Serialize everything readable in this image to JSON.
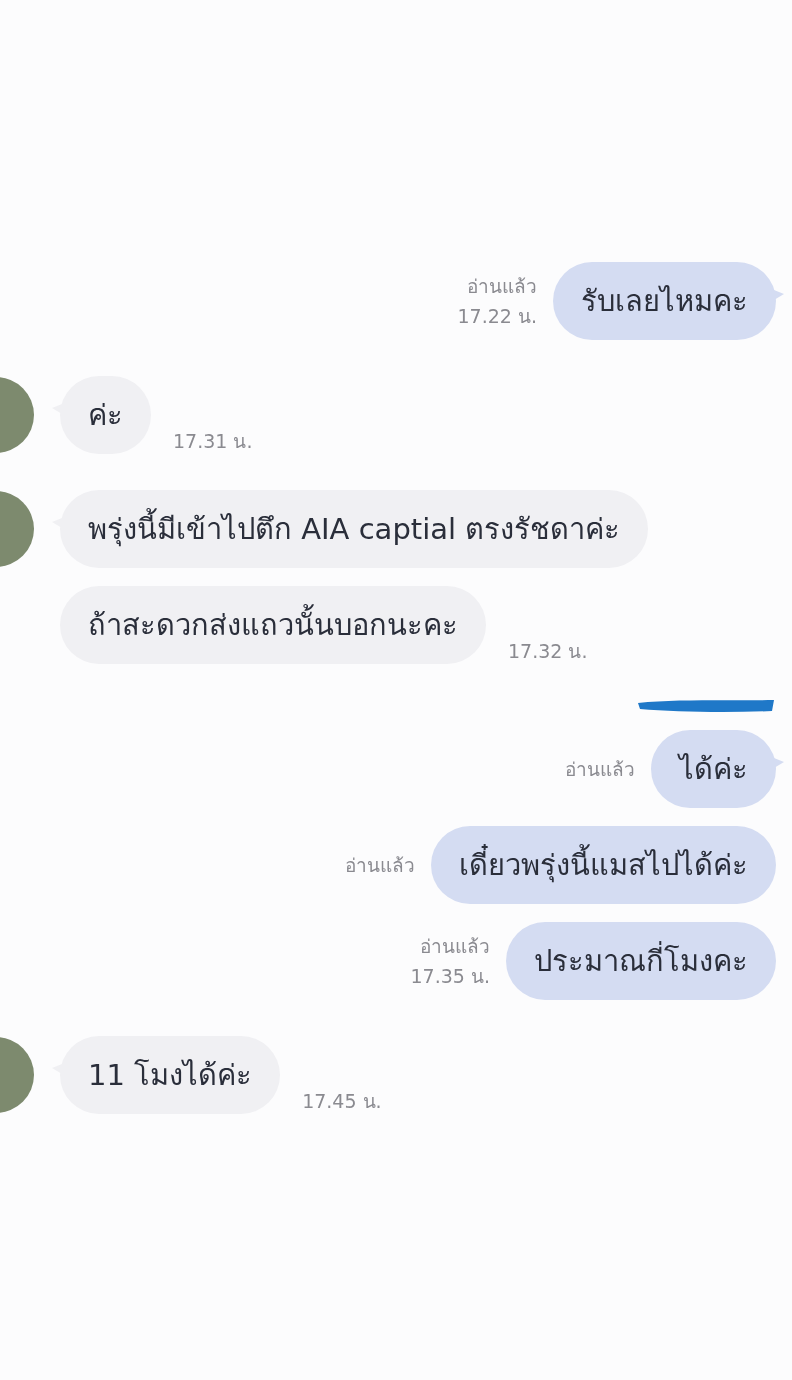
{
  "messages": [
    {
      "kind": "sent",
      "text": "รับเลยไหมคะ",
      "read": "อ่านแล้ว",
      "time": "17.22 น.",
      "tail": true,
      "redaction_above": false
    },
    {
      "kind": "received",
      "text": "ค่ะ",
      "time": "17.31 น.",
      "tail": true
    },
    {
      "kind": "received",
      "text": "พรุ่งนี้มีเข้าไปตึก AIA captial ตรงรัชดาค่ะ",
      "tail": true
    },
    {
      "kind": "received",
      "text": "ถ้าสะดวกส่งแถวนั้นบอกนะคะ",
      "time": "17.32 น.",
      "tail": false
    },
    {
      "kind": "sent",
      "text": "ได้ค่ะ",
      "read": "อ่านแล้ว",
      "tail": true,
      "redaction_above": true
    },
    {
      "kind": "sent",
      "text": "เดี๋ยวพรุ่งนี้แมสไปได้ค่ะ",
      "read": "อ่านแล้ว",
      "tail": false,
      "redaction_above": false
    },
    {
      "kind": "sent",
      "text": "ประมาณกี่โมงคะ",
      "read": "อ่านแล้ว",
      "time": "17.35 น.",
      "tail": false,
      "redaction_above": false
    },
    {
      "kind": "received",
      "text": "11 โมงได้ค่ะ",
      "time": "17.45 น.",
      "tail": true
    }
  ]
}
